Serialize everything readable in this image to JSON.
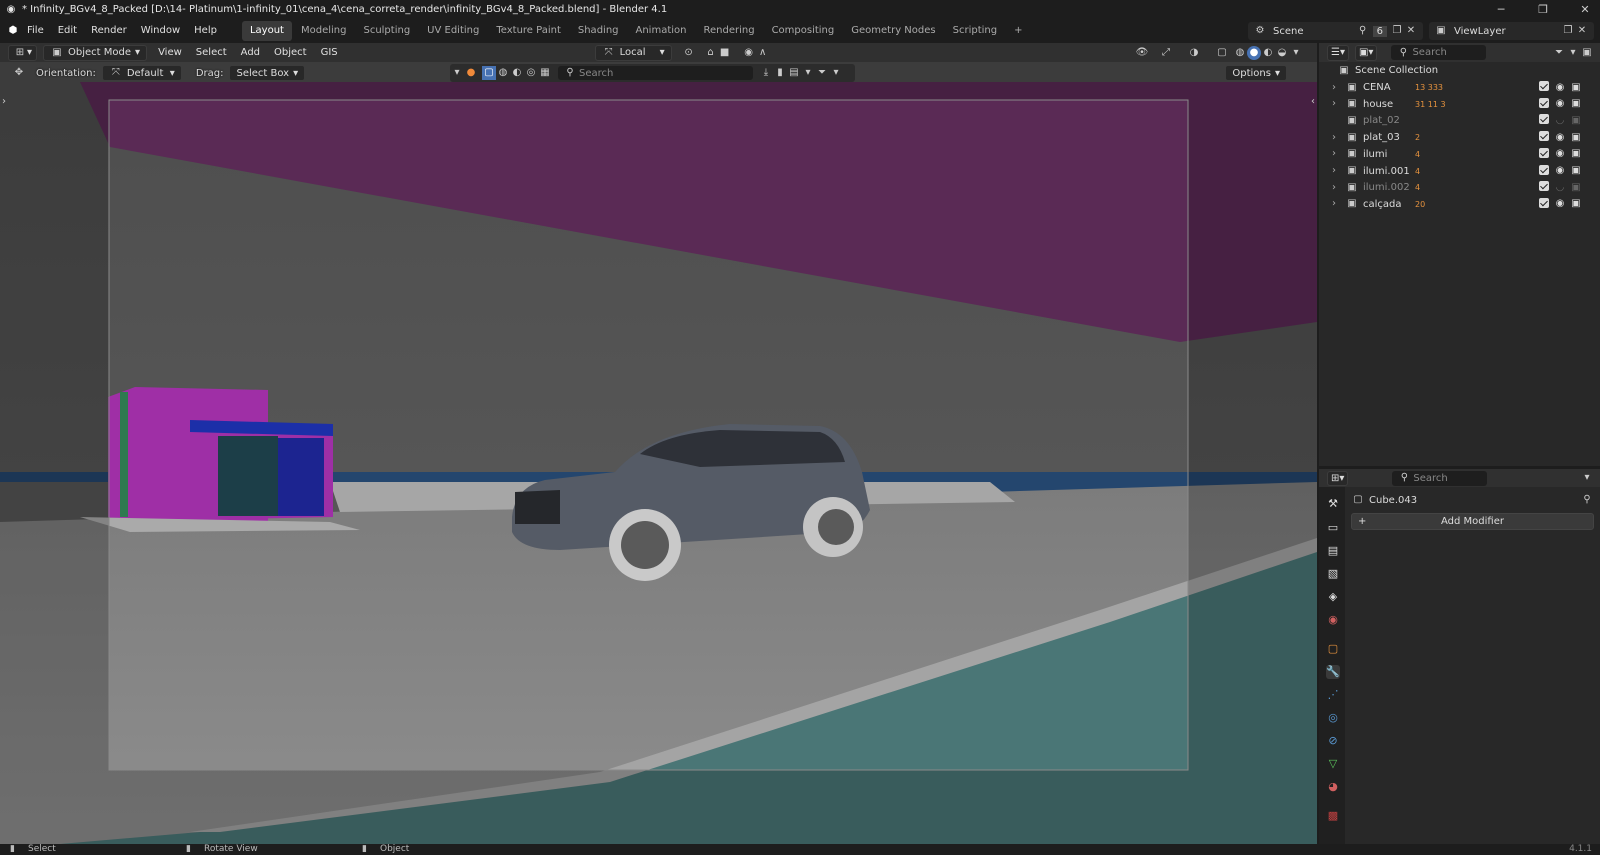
{
  "window": {
    "title": "* Infinity_BGv4_8_Packed [D:\\14- Platinum\\1-infinity_01\\cena_4\\cena_correta_render\\infinity_BGv4_8_Packed.blend] - Blender 4.1",
    "minimize": "─",
    "maximize": "❐",
    "close": "✕"
  },
  "menus": [
    "File",
    "Edit",
    "Render",
    "Window",
    "Help"
  ],
  "workspaces": [
    "Layout",
    "Modeling",
    "Sculpting",
    "UV Editing",
    "Texture Paint",
    "Shading",
    "Animation",
    "Rendering",
    "Compositing",
    "Geometry Nodes",
    "Scripting"
  ],
  "workspace_add": "+",
  "scene": {
    "name": "Scene",
    "count": "6",
    "view_layer": "ViewLayer"
  },
  "viewport_header": {
    "mode": "Object Mode",
    "menus": [
      "View",
      "Select",
      "Add",
      "Object",
      "GIS"
    ],
    "transform": "Local"
  },
  "tool_settings": {
    "orientation_label": "Orientation:",
    "orientation_value": "Default",
    "drag_label": "Drag:",
    "drag_value": "Select Box",
    "search_placeholder": "Search",
    "options": "Options"
  },
  "outliner": {
    "search_placeholder": "Search",
    "root": "Scene Collection",
    "items": [
      {
        "name": "CENA",
        "badges": "13 333",
        "dim": false
      },
      {
        "name": "house",
        "badges": "31 11 3",
        "dim": false
      },
      {
        "name": "plat_02",
        "badges": "",
        "dim": true
      },
      {
        "name": "plat_03",
        "badges": "2",
        "dim": false
      },
      {
        "name": "ilumi",
        "badges": "4",
        "dim": false
      },
      {
        "name": "ilumi.001",
        "badges": "4",
        "dim": false
      },
      {
        "name": "ilumi.002",
        "badges": "4",
        "dim": true
      },
      {
        "name": "calçada",
        "badges": "20",
        "dim": false
      }
    ]
  },
  "properties": {
    "search_placeholder": "Search",
    "object_name": "Cube.043",
    "add_modifier": "Add Modifier"
  },
  "status": {
    "select": "Select",
    "rotate": "Rotate View",
    "object": "Object",
    "version": "4.1.1"
  },
  "colors": {
    "accent": "#4772b3",
    "orange": "#e5923e",
    "purple_wall": "#5a2a55"
  }
}
